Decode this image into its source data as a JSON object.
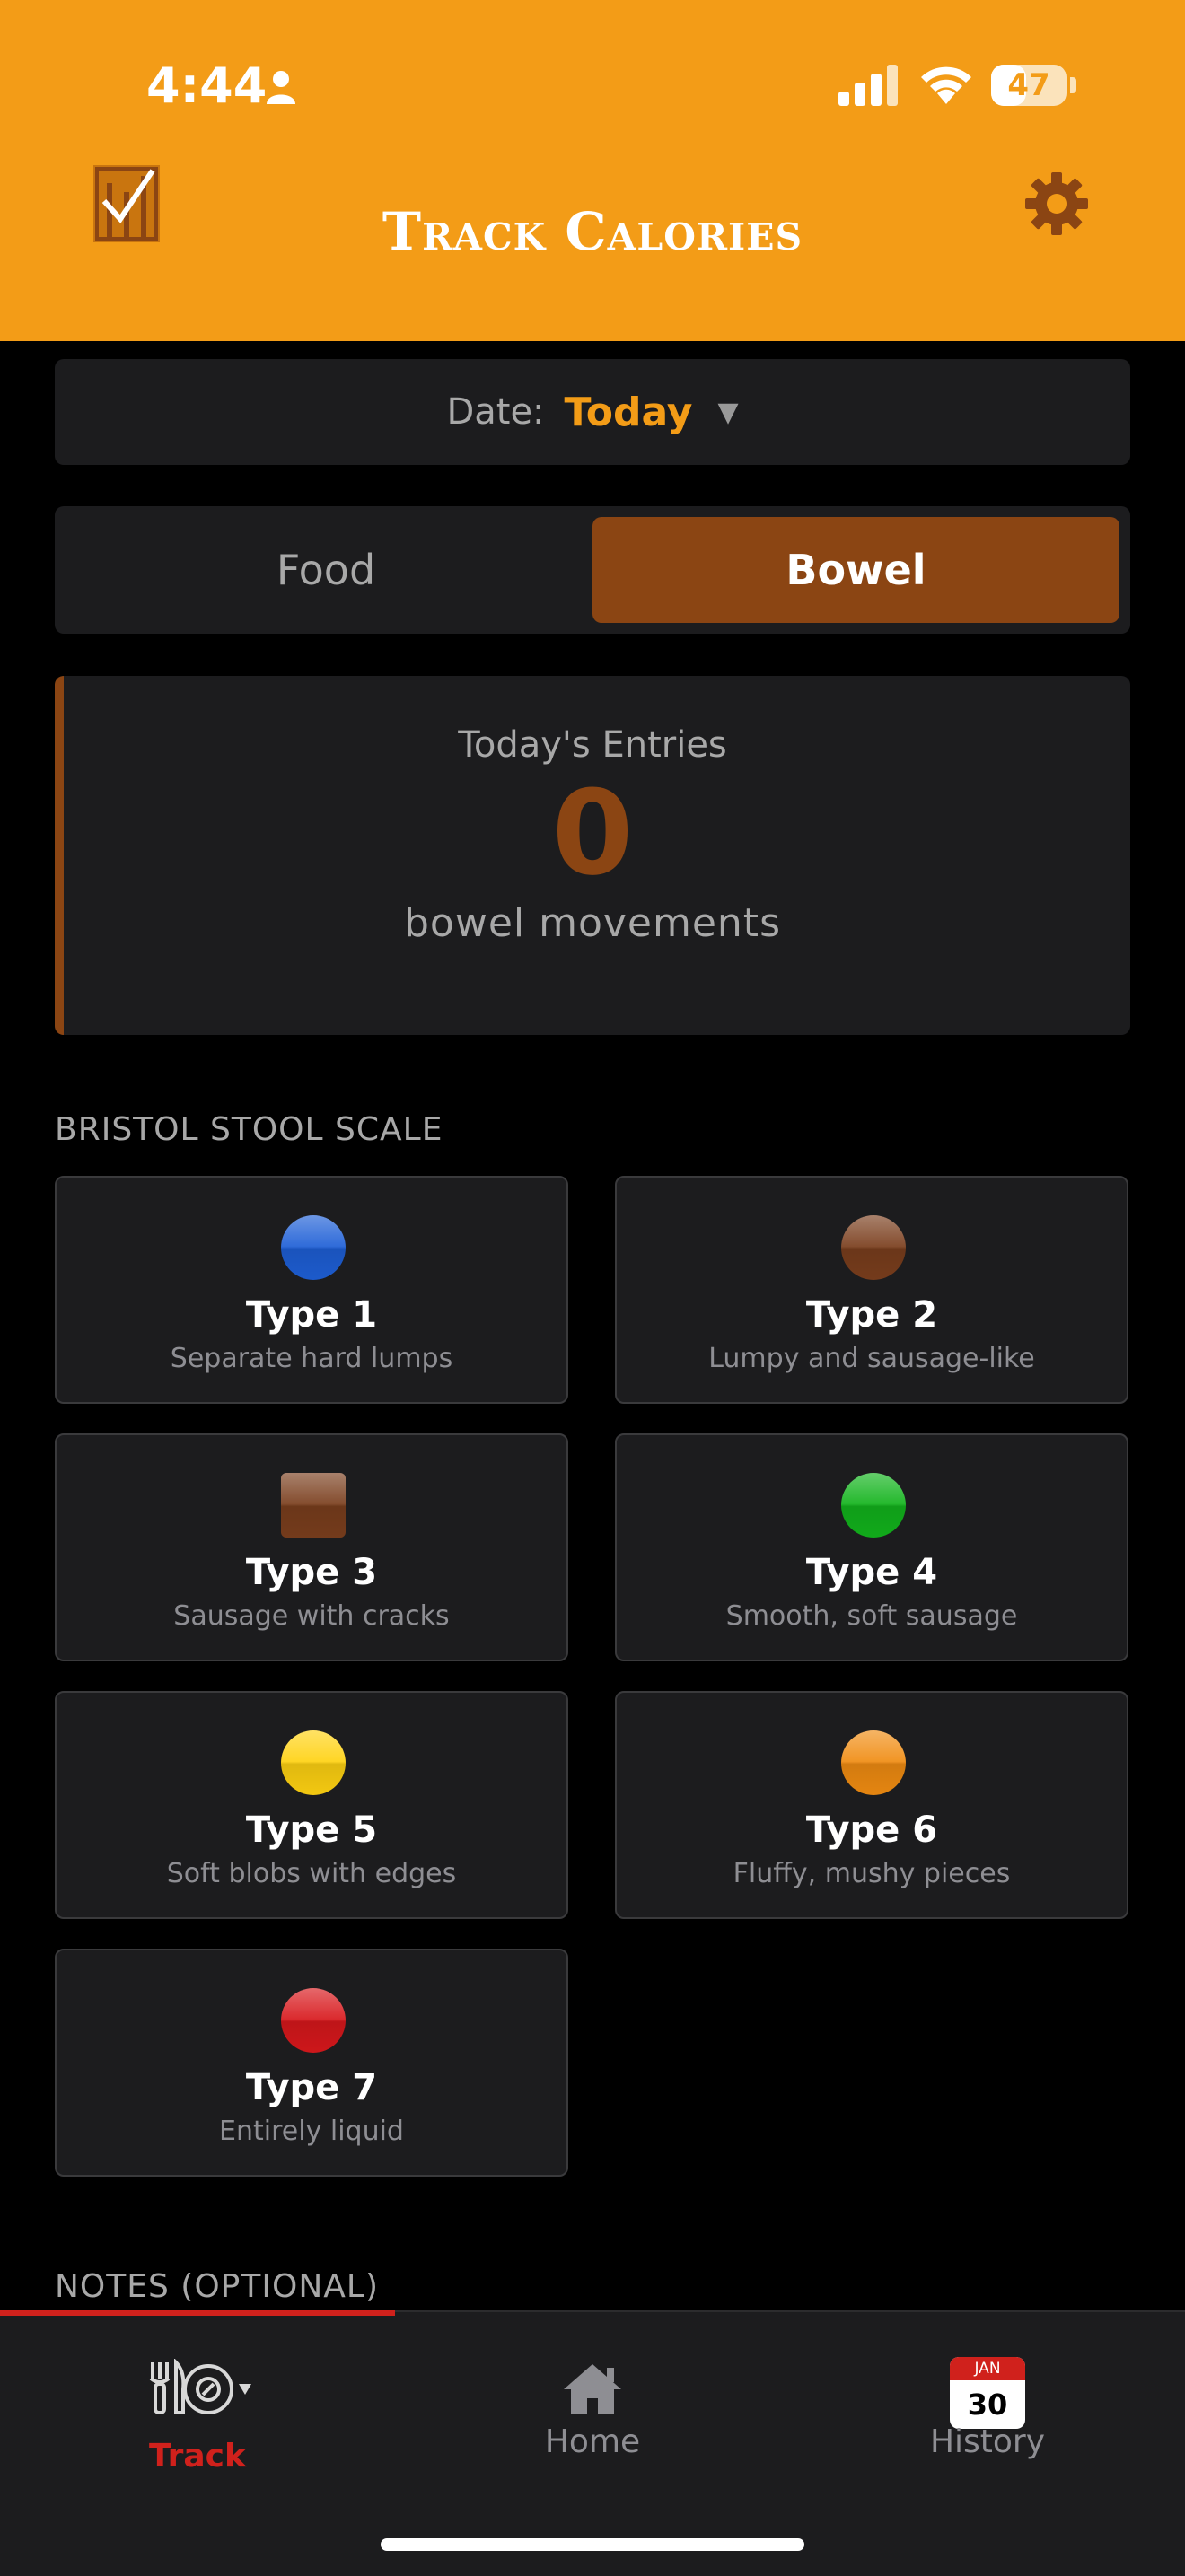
{
  "status_bar": {
    "time": "4:44",
    "battery": "47",
    "battery_level": 0.47
  },
  "header": {
    "title": "Track Calories"
  },
  "date_selector": {
    "label": "Date:",
    "value": "Today"
  },
  "mode_tabs": [
    {
      "label": "Food",
      "selected": false
    },
    {
      "label": "Bowel",
      "selected": true
    }
  ],
  "entries": {
    "title": "Today's Entries",
    "count": "0",
    "unit": "bowel movements"
  },
  "scale": {
    "heading": "BRISTOL STOOL SCALE",
    "types": [
      {
        "name": "Type 1",
        "description": "Separate hard lumps",
        "color": "#1e5fd6",
        "shape": "circle"
      },
      {
        "name": "Type 2",
        "description": "Lumpy and sausage-like",
        "color": "#7a3e1d",
        "shape": "circle"
      },
      {
        "name": "Type 3",
        "description": "Sausage with cracks",
        "color": "#7a3e1d",
        "shape": "square"
      },
      {
        "name": "Type 4",
        "description": "Smooth, soft sausage",
        "color": "#12b31c",
        "shape": "circle"
      },
      {
        "name": "Type 5",
        "description": "Soft blobs with edges",
        "color": "#ffd212",
        "shape": "circle"
      },
      {
        "name": "Type 6",
        "description": "Fluffy, mushy pieces",
        "color": "#f08c12",
        "shape": "circle"
      },
      {
        "name": "Type 7",
        "description": "Entirely liquid",
        "color": "#d8181c",
        "shape": "circle"
      }
    ]
  },
  "notes": {
    "heading": "NOTES (OPTIONAL)"
  },
  "tab_bar": {
    "items": [
      {
        "label": "Track",
        "icon": "fork-knife-plate-icon",
        "active": true
      },
      {
        "label": "Home",
        "icon": "home-icon",
        "active": false
      },
      {
        "label": "History",
        "icon": "calendar-icon",
        "active": false
      }
    ],
    "calendar_month": "JAN",
    "calendar_day": "30"
  },
  "colors": {
    "header": "#f39c17",
    "accent_brown": "#8b4513",
    "active_tab": "#d0211c"
  }
}
